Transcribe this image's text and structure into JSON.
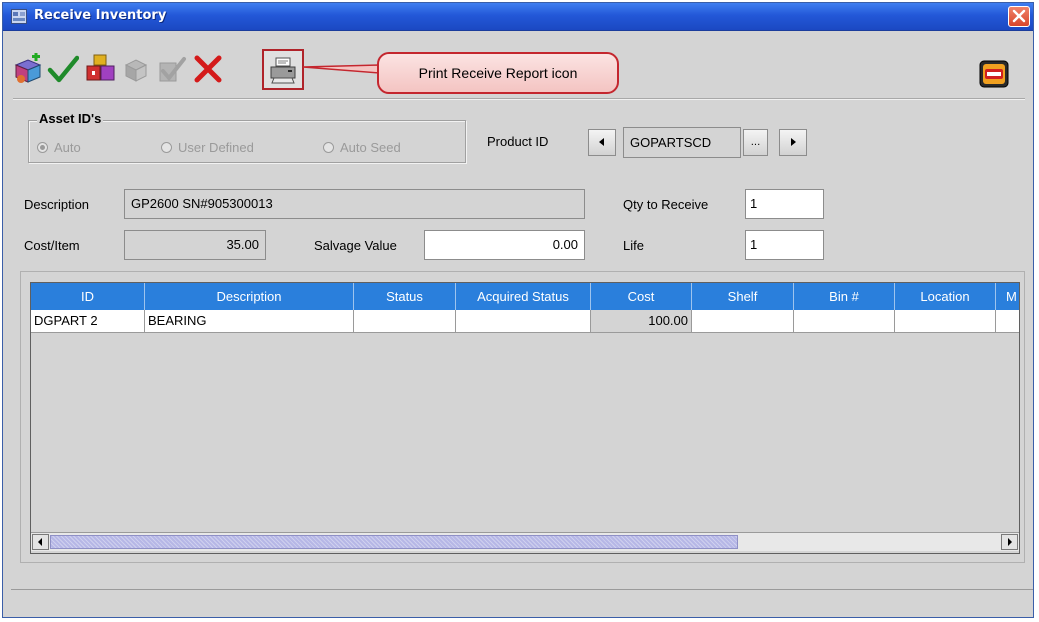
{
  "window": {
    "title": "Receive Inventory"
  },
  "callout": {
    "text": "Print Receive Report icon"
  },
  "asset_ids": {
    "legend": "Asset ID's",
    "options": [
      "Auto",
      "User Defined",
      "Auto Seed"
    ],
    "selected": "Auto"
  },
  "product": {
    "label": "Product ID",
    "value": "GOPARTSCD",
    "browse_label": "..."
  },
  "description": {
    "label": "Description",
    "value": "GP2600 SN#905300013"
  },
  "qty": {
    "label": "Qty to Receive",
    "value": "1"
  },
  "cost_item": {
    "label": "Cost/Item",
    "value": "35.00"
  },
  "salvage": {
    "label": "Salvage Value",
    "value": "0.00"
  },
  "life": {
    "label": "Life",
    "value": "1"
  },
  "table": {
    "columns": [
      "ID",
      "Description",
      "Status",
      "Acquired Status",
      "Cost",
      "Shelf",
      "Bin #",
      "Location",
      "M"
    ],
    "rows": [
      [
        "DGPART 2",
        "BEARING",
        "",
        "",
        "100.00",
        "",
        "",
        "",
        ""
      ]
    ]
  },
  "icons": {
    "toolbar": [
      "add-item-icon",
      "accept-check-icon",
      "receive-boxes-icon",
      "disabled-boxes-icon",
      "disabled-check-icon",
      "delete-x-icon",
      "print-receive-report-icon"
    ],
    "exit": "exit-icon"
  },
  "colors": {
    "title_bar": "#2358d8",
    "table_header": "#2a7fdc",
    "callout_border": "#c4262e",
    "scroll_thumb": "#b6b7e6"
  }
}
